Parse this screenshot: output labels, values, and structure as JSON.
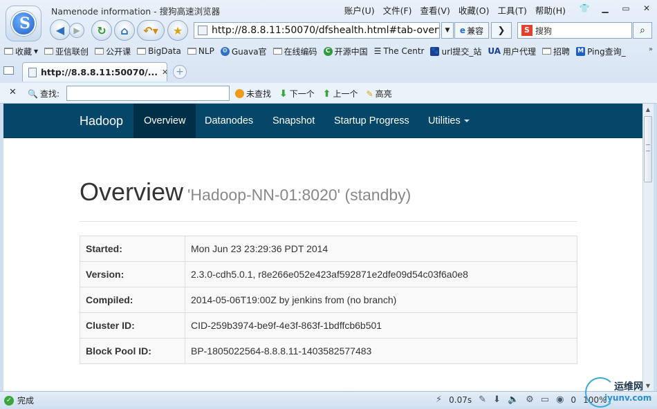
{
  "window": {
    "title": "Namenode information - 搜狗高速浏览器"
  },
  "menu": [
    "账户(U)",
    "文件(F)",
    "查看(V)",
    "收藏(O)",
    "工具(T)",
    "帮助(H)"
  ],
  "toolbar": {
    "url": "http://8.8.8.11:50070/dfshealth.html#tab-overview",
    "compat_label": "兼容",
    "search_placeholder": "搜狗"
  },
  "bookmarks": [
    "收藏",
    "亚信联创",
    "公开课",
    "BigData",
    "NLP",
    "Guava官",
    "在线编码",
    "开源中国",
    "The Centr",
    "url提交_站",
    "用户代理",
    "招聘",
    "Ping查询_"
  ],
  "tab": {
    "title": "http://8.8.8.11:50070/..."
  },
  "findbar": {
    "label": "查找:",
    "value": "",
    "opts": [
      "未查找",
      "下一个",
      "上一个",
      "高亮"
    ]
  },
  "page": {
    "brand": "Hadoop",
    "nav": [
      "Overview",
      "Datanodes",
      "Snapshot",
      "Startup Progress",
      "Utilities"
    ],
    "title": "Overview",
    "subtitle": "'Hadoop-NN-01:8020' (standby)",
    "rows": [
      {
        "k": "Started:",
        "v": "Mon Jun 23 23:29:36 PDT 2014"
      },
      {
        "k": "Version:",
        "v": "2.3.0-cdh5.0.1, r8e266e052e423af592871e2dfe09d54c03f6a0e8"
      },
      {
        "k": "Compiled:",
        "v": "2014-05-06T19:00Z by jenkins from (no branch)"
      },
      {
        "k": "Cluster ID:",
        "v": "CID-259b3974-be9f-4e3f-863f-1bdffcb6b501"
      },
      {
        "k": "Block Pool ID:",
        "v": "BP-1805022564-8.8.8.11-1403582577483"
      }
    ]
  },
  "status": {
    "left": "完成",
    "time": "0.07s",
    "count": "0",
    "zoom": "100%"
  },
  "watermark": {
    "text": "运维网",
    "sub": "iyunv.com"
  },
  "colors": {
    "navbar": "#054669",
    "navbar_active": "#022f48"
  }
}
